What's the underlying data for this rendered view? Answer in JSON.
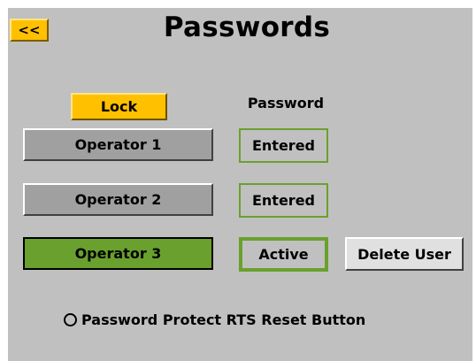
{
  "header": {
    "back_label": "<<",
    "title": "Passwords"
  },
  "controls": {
    "lock_label": "Lock",
    "password_column_header": "Password"
  },
  "operators": [
    {
      "label": "Operator 1",
      "status": "Entered",
      "active": false
    },
    {
      "label": "Operator 2",
      "status": "Entered",
      "active": false
    },
    {
      "label": "Operator 3",
      "status": "Active",
      "active": true
    }
  ],
  "actions": {
    "delete_user_label": "Delete User"
  },
  "options": {
    "protect_reset_label": "Password Protect RTS Reset Button",
    "protect_reset_checked": false
  },
  "colors": {
    "accent_yellow": "#ffc000",
    "active_green": "#6aa02e",
    "panel_gray": "#c0c0c0"
  }
}
